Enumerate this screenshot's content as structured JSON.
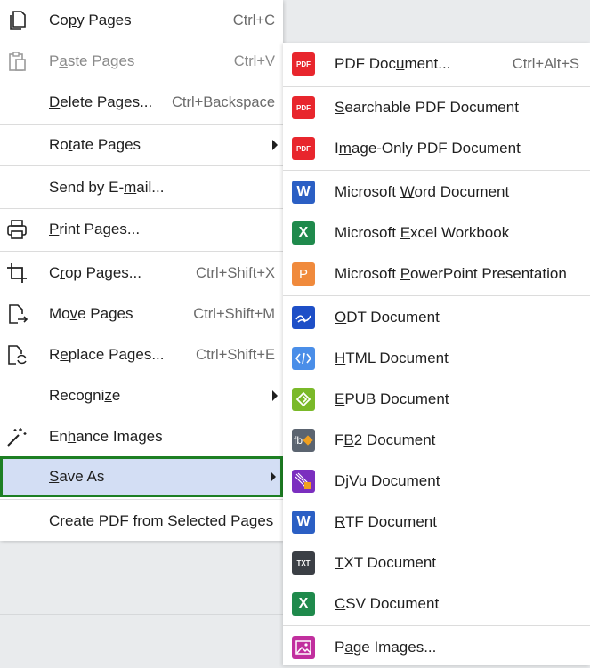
{
  "main_menu": {
    "items": [
      {
        "label_pre": "Co",
        "label_u": "p",
        "label_post": "y Pages",
        "shortcut": "Ctrl+C",
        "icon": "copy-icon"
      },
      {
        "label_pre": "P",
        "label_u": "a",
        "label_post": "ste Pages",
        "shortcut": "Ctrl+V",
        "icon": "paste-icon"
      },
      {
        "label_pre": "",
        "label_u": "D",
        "label_post": "elete Pages...",
        "shortcut": "Ctrl+Backspace"
      },
      {
        "label_pre": "Ro",
        "label_u": "t",
        "label_post": "ate Pages"
      },
      {
        "label_pre": "Send by E-",
        "label_u": "m",
        "label_post": "ail..."
      },
      {
        "label_pre": "",
        "label_u": "P",
        "label_post": "rint Pages...",
        "icon": "printer-icon"
      },
      {
        "label_pre": "C",
        "label_u": "r",
        "label_post": "op Pages...",
        "shortcut": "Ctrl+Shift+X",
        "icon": "crop-icon"
      },
      {
        "label_pre": "Mo",
        "label_u": "v",
        "label_post": "e Pages",
        "shortcut": "Ctrl+Shift+M",
        "icon": "move-pages-icon"
      },
      {
        "label_pre": "R",
        "label_u": "e",
        "label_post": "place Pages...",
        "shortcut": "Ctrl+Shift+E",
        "icon": "replace-pages-icon"
      },
      {
        "label_pre": "Recogni",
        "label_u": "z",
        "label_post": "e"
      },
      {
        "label_pre": "En",
        "label_u": "h",
        "label_post": "ance Images",
        "icon": "magic-wand-icon"
      },
      {
        "label_pre": "",
        "label_u": "S",
        "label_post": "ave As"
      },
      {
        "label_pre": "",
        "label_u": "C",
        "label_post": "reate PDF from Selected Pages"
      }
    ]
  },
  "save_as_menu": {
    "items": [
      {
        "label_pre": "PDF Doc",
        "label_u": "u",
        "label_post": "ment...",
        "shortcut": "Ctrl+Alt+S",
        "badge": "PDF",
        "color": "#e8262d"
      },
      {
        "label_pre": "",
        "label_u": "S",
        "label_post": "earchable PDF Document",
        "badge": "PDF",
        "color": "#e8262d"
      },
      {
        "label_pre": "I",
        "label_u": "m",
        "label_post": "age-Only PDF Document",
        "badge": "PDF",
        "color": "#e8262d"
      },
      {
        "label_pre": "Microsoft ",
        "label_u": "W",
        "label_post": "ord Document",
        "badge": "W",
        "color": "#2b5fc4"
      },
      {
        "label_pre": "Microsoft ",
        "label_u": "E",
        "label_post": "xcel Workbook",
        "badge": "X",
        "color": "#1f8a4c"
      },
      {
        "label_pre": "Microsoft ",
        "label_u": "P",
        "label_post": "owerPoint Presentation",
        "badge": "P",
        "color": "#f08a3c"
      },
      {
        "label_pre": "",
        "label_u": "O",
        "label_post": "DT Document",
        "color": "#1e4fc7"
      },
      {
        "label_pre": "",
        "label_u": "H",
        "label_post": "TML Document",
        "color": "#4a8ee8"
      },
      {
        "label_pre": "",
        "label_u": "E",
        "label_post": "PUB Document",
        "color": "#7ab929"
      },
      {
        "label_pre": "F",
        "label_u": "B",
        "label_post": "2 Document",
        "badge": "fb",
        "color": "#5b6470"
      },
      {
        "label_pre": "D",
        "label_u": "j",
        "label_post": "Vu Document",
        "color": "#7b2fbf"
      },
      {
        "label_pre": "",
        "label_u": "R",
        "label_post": "TF Document",
        "badge": "W",
        "color": "#2b5fc4"
      },
      {
        "label_pre": "",
        "label_u": "T",
        "label_post": "XT Document",
        "badge": "TXT",
        "color": "#3b3f45"
      },
      {
        "label_pre": "",
        "label_u": "C",
        "label_post": "SV Document",
        "badge": "X",
        "color": "#1f8a4c"
      },
      {
        "label_pre": "P",
        "label_u": "a",
        "label_post": "ge Images...",
        "color": "#c12f9e"
      }
    ]
  }
}
